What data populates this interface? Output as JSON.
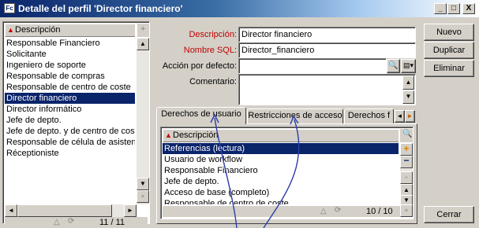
{
  "window": {
    "title": "Detalle del perfil 'Director financiero'",
    "icon": "profile-icon",
    "controls": [
      "_",
      "□",
      "X"
    ]
  },
  "profiles_list": {
    "header": "Descripción",
    "items": [
      "Responsable Financiero",
      "Solicitante",
      "Ingeniero de soporte",
      "Responsable de compras",
      "Responsable de centro de coste",
      "Director financiero",
      "Director informático",
      "Jefe de depto.",
      "Jefe de depto. y de centro de cos",
      "Responsable de célula de asisten",
      "Réceptioniste"
    ],
    "selected_index": 5,
    "counter": "11 / 11"
  },
  "form": {
    "descripcion_label": "Descripción:",
    "descripcion_value": "Director financiero",
    "nombre_sql_label": "Nombre SQL:",
    "nombre_sql_value": "Director_financiero",
    "accion_label": "Acción por defecto:",
    "accion_value": "",
    "comentario_label": "Comentario:",
    "comentario_value": ""
  },
  "tabs": [
    "Derechos de usuario",
    "Restricciones de acceso",
    "Derechos f"
  ],
  "active_tab": 0,
  "rights_list": {
    "header": "Descripción",
    "items": [
      "Referencias (lectura)",
      "Usuario de workflow",
      "Responsable Financiero",
      "Jefe de depto.",
      "Acceso de base (completo)",
      "Responsable de centro de coste"
    ],
    "selected_index": 0,
    "counter": "10 / 10"
  },
  "buttons": {
    "nuevo": "Nuevo",
    "duplicar": "Duplicar",
    "eliminar": "Eliminar",
    "cerrar": "Cerrar"
  },
  "colors": {
    "selection": "#0a246a",
    "required_label": "#c00000",
    "accent_plus": "#e08000",
    "annotation_arrow": "#2b3fa8"
  }
}
